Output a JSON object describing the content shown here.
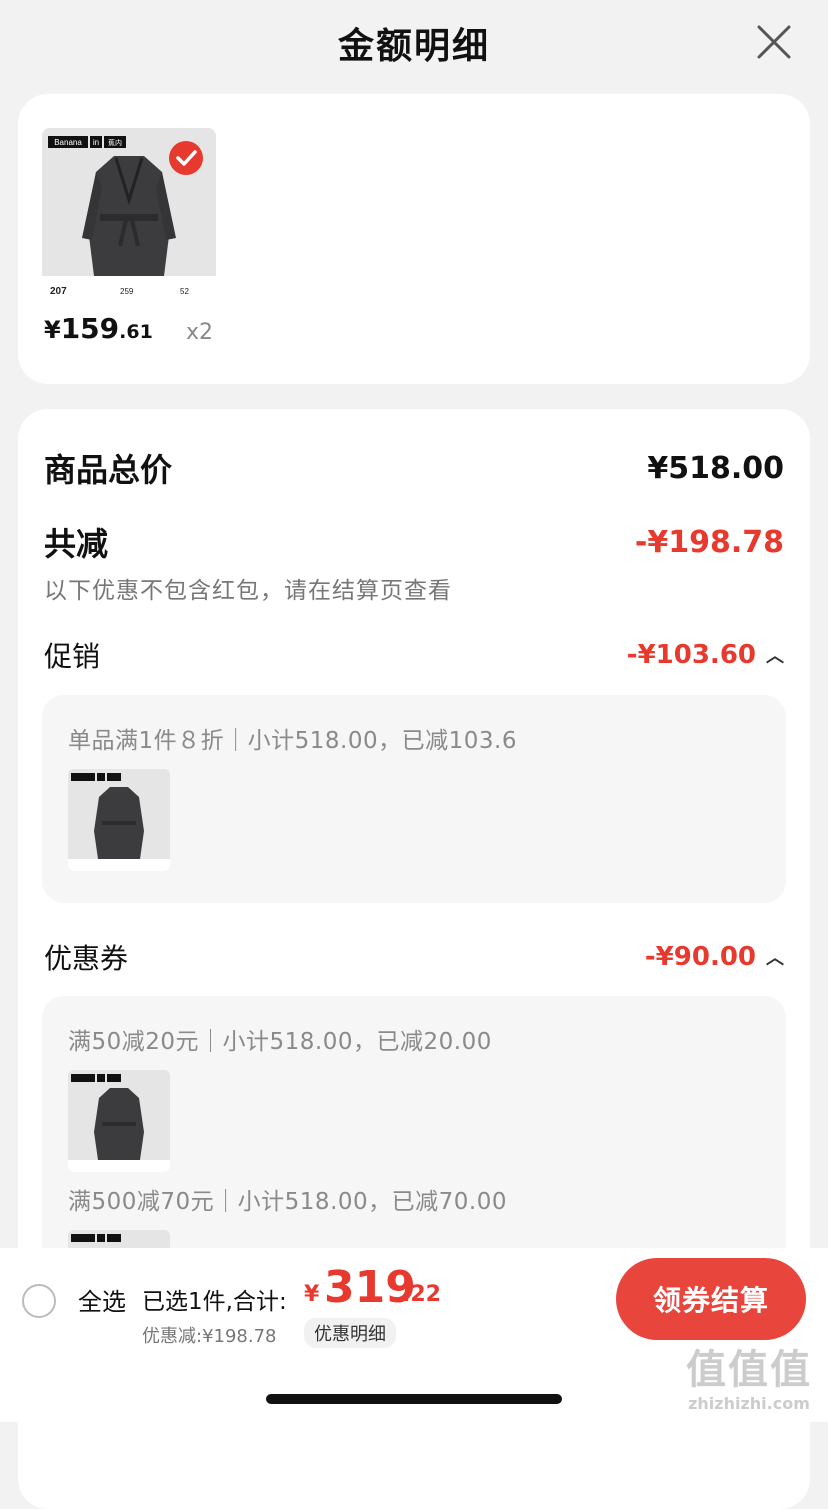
{
  "header": {
    "title": "金额明细"
  },
  "product": {
    "tag_brand": "Banana",
    "tag_in": "in",
    "tag_extra": "蕉内",
    "img_num_left": "207",
    "img_num_mid": "259",
    "img_num_right": "52",
    "price_yen": "¥",
    "price_int": "159",
    "price_dec": ".61",
    "qty": "x2"
  },
  "summary": {
    "total_label": "商品总价",
    "total_value": "¥518.00",
    "reduce_label": "共减",
    "reduce_value": "-¥198.78",
    "note": "以下优惠不包含红包，请在结算页查看"
  },
  "promo": {
    "label": "促销",
    "value": "-¥103.60",
    "detail": "单品满1件８折｜小计518.00，已减103.6"
  },
  "coupon": {
    "label": "优惠券",
    "value": "-¥90.00",
    "detail1": "满50减20元｜小计518.00，已减20.00",
    "detail2": "满500减70元｜小计518.00，已减70.00"
  },
  "footer": {
    "select_all": "全选",
    "selected_summary": "已选1件,合计:",
    "total_yen": "¥",
    "total_int": "319",
    "total_dec": ".22",
    "discount_text": "优惠减:¥198.78",
    "detail_link": "优惠明细",
    "checkout_btn": "领券结算"
  },
  "watermark": {
    "big": "值值值",
    "small": "zhizhizhi.com"
  },
  "colors": {
    "accent_red": "#e8392f",
    "button_red": "#e8453c"
  }
}
